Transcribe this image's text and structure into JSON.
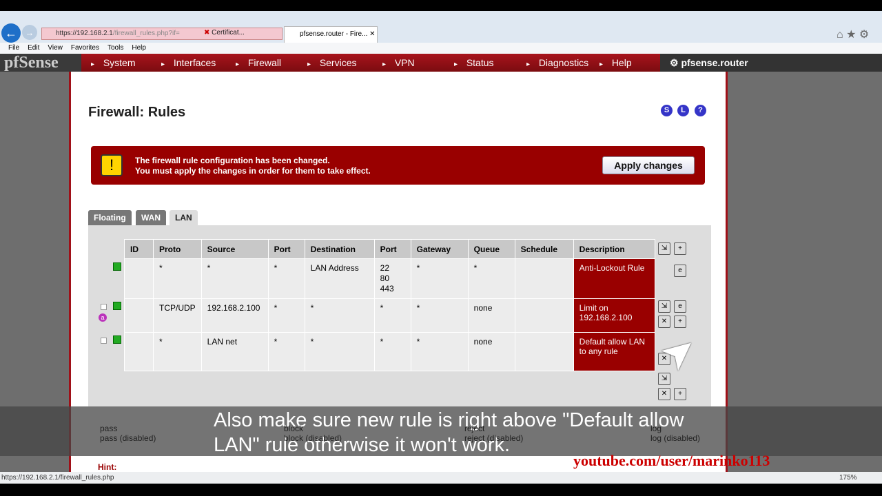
{
  "browser": {
    "url_host": "https://192.168.2.1",
    "url_path": "/firewall_rules.php?if=",
    "cert": "Certificat...",
    "tab_title": "pfsense.router - Fire...",
    "menu": [
      "File",
      "Edit",
      "View",
      "Favorites",
      "Tools",
      "Help"
    ],
    "status_url": "https://192.168.2.1/firewall_rules.php",
    "zoom": "175%"
  },
  "nav": {
    "logo": "pfSense",
    "items": [
      "System",
      "Interfaces",
      "Firewall",
      "Services",
      "VPN",
      "Status",
      "Diagnostics",
      "Help"
    ],
    "host": "pfsense.router"
  },
  "page": {
    "title": "Firewall: Rules",
    "icons": [
      "S",
      "L",
      "?"
    ]
  },
  "alert": {
    "line1": "The firewall rule configuration has been changed.",
    "line2": "You must apply the changes in order for them to take effect.",
    "button": "Apply changes"
  },
  "tabs": [
    "Floating",
    "WAN",
    "LAN"
  ],
  "table": {
    "headers": [
      "ID",
      "Proto",
      "Source",
      "Port",
      "Destination",
      "Port",
      "Gateway",
      "Queue",
      "Schedule",
      "Description"
    ],
    "rows": [
      [
        "",
        "*",
        "*",
        "*",
        "LAN Address",
        "22\n80\n443",
        "*",
        "*",
        "",
        "Anti-Lockout Rule"
      ],
      [
        "",
        "TCP/UDP",
        "192.168.2.100",
        "*",
        "*",
        "*",
        "*",
        "none",
        "",
        "Limit on 192.168.2.100"
      ],
      [
        "",
        "*",
        "LAN net",
        "*",
        "*",
        "*",
        "*",
        "none",
        "",
        "Default allow LAN to any rule"
      ]
    ]
  },
  "legend": {
    "pass": "pass",
    "pass_dis": "pass (disabled)",
    "block": "block",
    "block_dis": "block (disabled)",
    "reject": "reject",
    "reject_dis": "reject (disabled)",
    "log": "log",
    "log_dis": "log (disabled)",
    "hint": "Hint:"
  },
  "subtitle": "Also make sure new rule is right above \"Default allow LAN\" rule otherwise it won't work.",
  "watermark": "youtube.com/user/marinko113"
}
